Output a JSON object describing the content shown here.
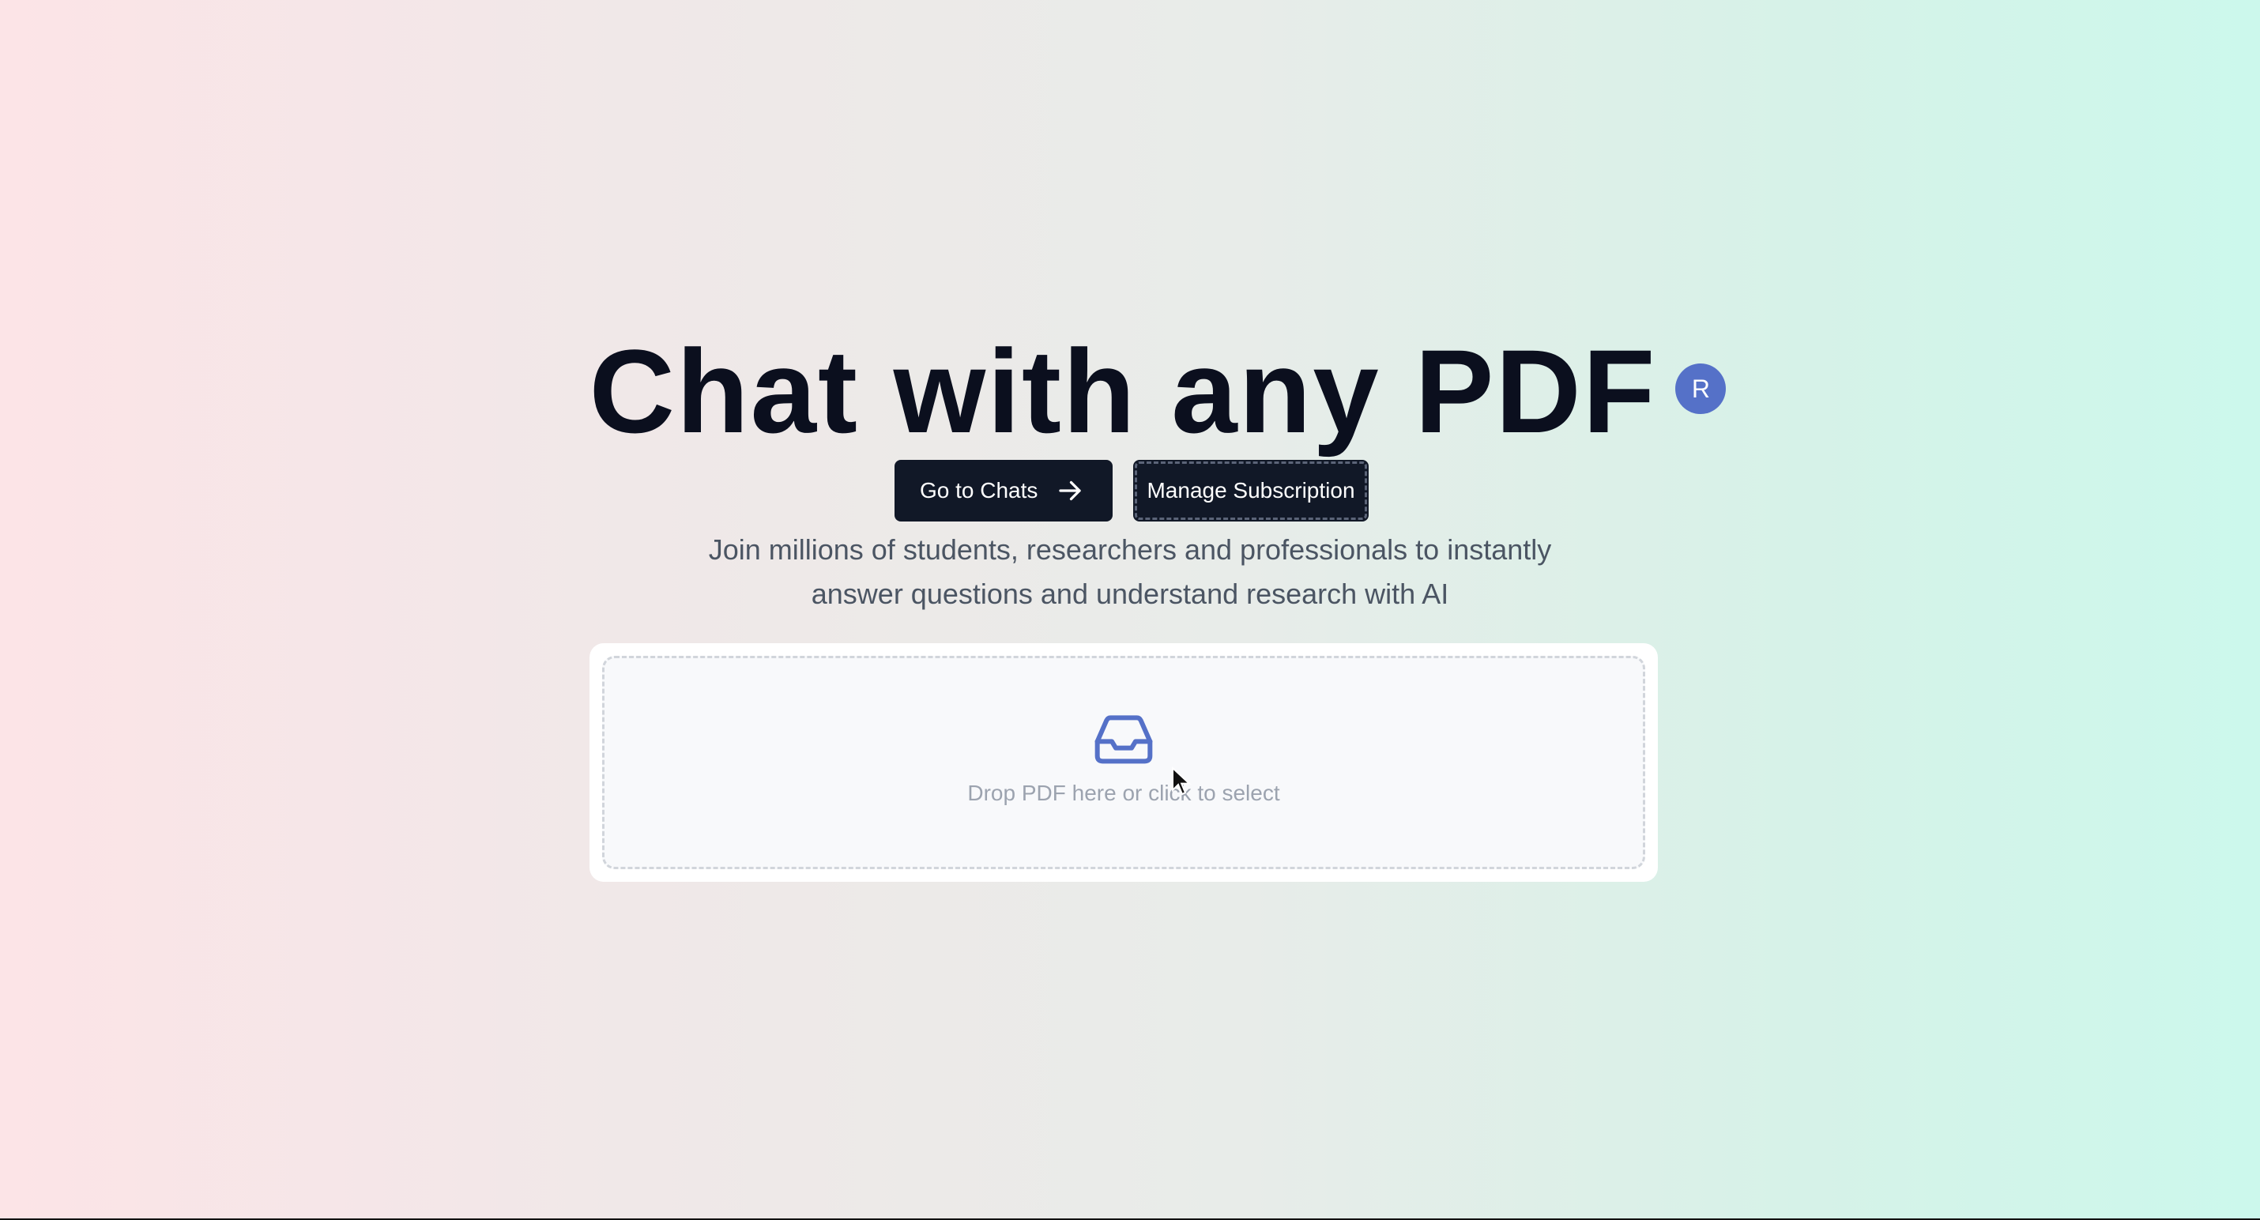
{
  "hero": {
    "title": "Chat with any PDF",
    "avatar_initial": "R",
    "subtitle_line1": "Join millions of students, researchers and professionals to instantly",
    "subtitle_line2": "answer questions and understand research with AI"
  },
  "actions": {
    "go_to_chats_label": "Go to Chats",
    "manage_subscription_label": "Manage Subscription"
  },
  "upload": {
    "prompt": "Drop PDF here or click to select",
    "icon": "inbox-icon"
  },
  "colors": {
    "button_bg": "#111827",
    "accent": "#5571c8",
    "title": "#0b0f1e"
  }
}
